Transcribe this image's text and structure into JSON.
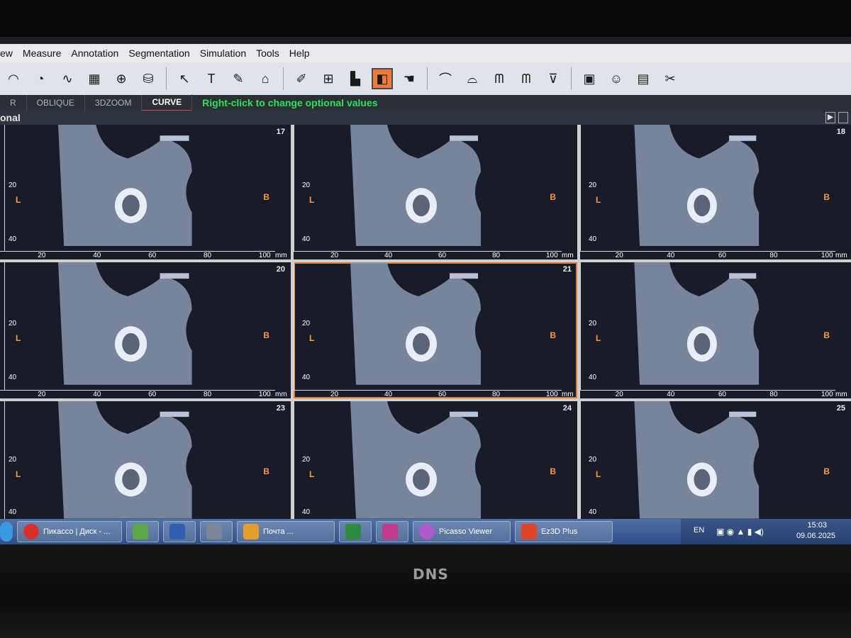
{
  "menu": [
    "ew",
    "Measure",
    "Annotation",
    "Segmentation",
    "Simulation",
    "Tools",
    "Help"
  ],
  "toolbar_icons": [
    "gauge-icon",
    "3d-gauge-icon",
    "waveform-icon",
    "grid-select-icon",
    "globe-icon",
    "cylinder-icon",
    "cursor-icon",
    "text-icon",
    "pencil-icon",
    "stamp-icon",
    "edit-image-icon",
    "zoom-box-icon",
    "histogram-icon",
    "layers-icon",
    "hand-icon",
    "arc-icon",
    "arc-measure-icon",
    "teeth-icon",
    "teeth-measure-icon",
    "implant-icon",
    "camera-icon",
    "person-icon",
    "panel-icon",
    "tools-icon"
  ],
  "tabs": [
    "R",
    "OBLIQUE",
    "3DZOOM",
    "CURVE"
  ],
  "active_tab": "CURVE",
  "hint": "Right-click to change optional values",
  "panel_title": "onal",
  "slices": [
    {
      "num": "17"
    },
    {
      "num": ""
    },
    {
      "num": "18"
    },
    {
      "num": "20"
    },
    {
      "num": "21"
    },
    {
      "num": ""
    },
    {
      "num": "23"
    },
    {
      "num": "24"
    },
    {
      "num": "25"
    }
  ],
  "markers": {
    "left": "L",
    "right": "B"
  },
  "x_ticks": [
    "20",
    "40",
    "60",
    "80",
    "100"
  ],
  "x_unit": "mm",
  "y_ticks": [
    "20",
    "40"
  ],
  "taskbar": {
    "items": [
      "Пикассо | Диск - ...",
      "",
      "",
      "",
      "Почта ...",
      "",
      "",
      "Picasso Viewer",
      "Ez3D Plus"
    ],
    "lang": "EN",
    "time": "15:03",
    "date": "09.06.2025"
  },
  "brand": "DNS"
}
